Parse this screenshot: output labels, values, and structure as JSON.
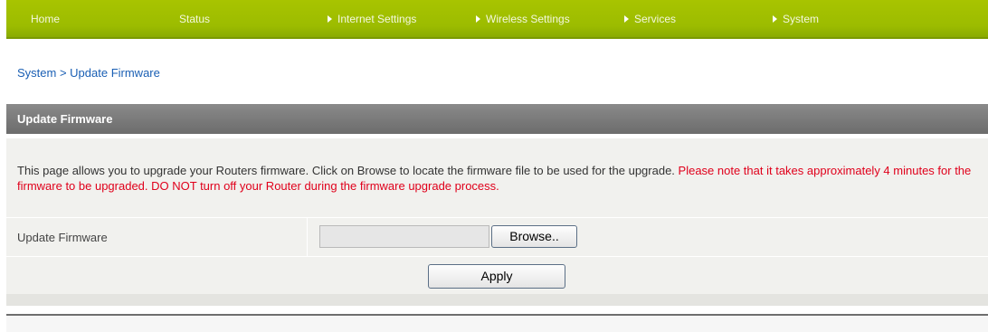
{
  "nav": {
    "items": [
      {
        "label": "Home",
        "arrow": false
      },
      {
        "label": "Status",
        "arrow": false
      },
      {
        "label": "Internet Settings",
        "arrow": true
      },
      {
        "label": "Wireless Settings",
        "arrow": true
      },
      {
        "label": "Services",
        "arrow": true
      },
      {
        "label": "System",
        "arrow": true
      }
    ]
  },
  "breadcrumb": "System > Update Firmware",
  "section": {
    "title": "Update Firmware",
    "description": "This page allows you to upgrade your Routers firmware. Click on Browse to locate the firmware file to be used for the upgrade. ",
    "warning": "Please note that it takes approximately 4 minutes for the firmware to be upgraded. DO NOT turn off your Router during the firmware upgrade process."
  },
  "form": {
    "firmware_label": "Update Firmware",
    "file_value": "",
    "browse_label": "Browse..",
    "apply_label": "Apply"
  },
  "colors": {
    "nav_green": "#9cbc00",
    "header_gray": "#6c6c6c",
    "warning_red": "#e0001b",
    "link_blue": "#1a5fb4"
  }
}
